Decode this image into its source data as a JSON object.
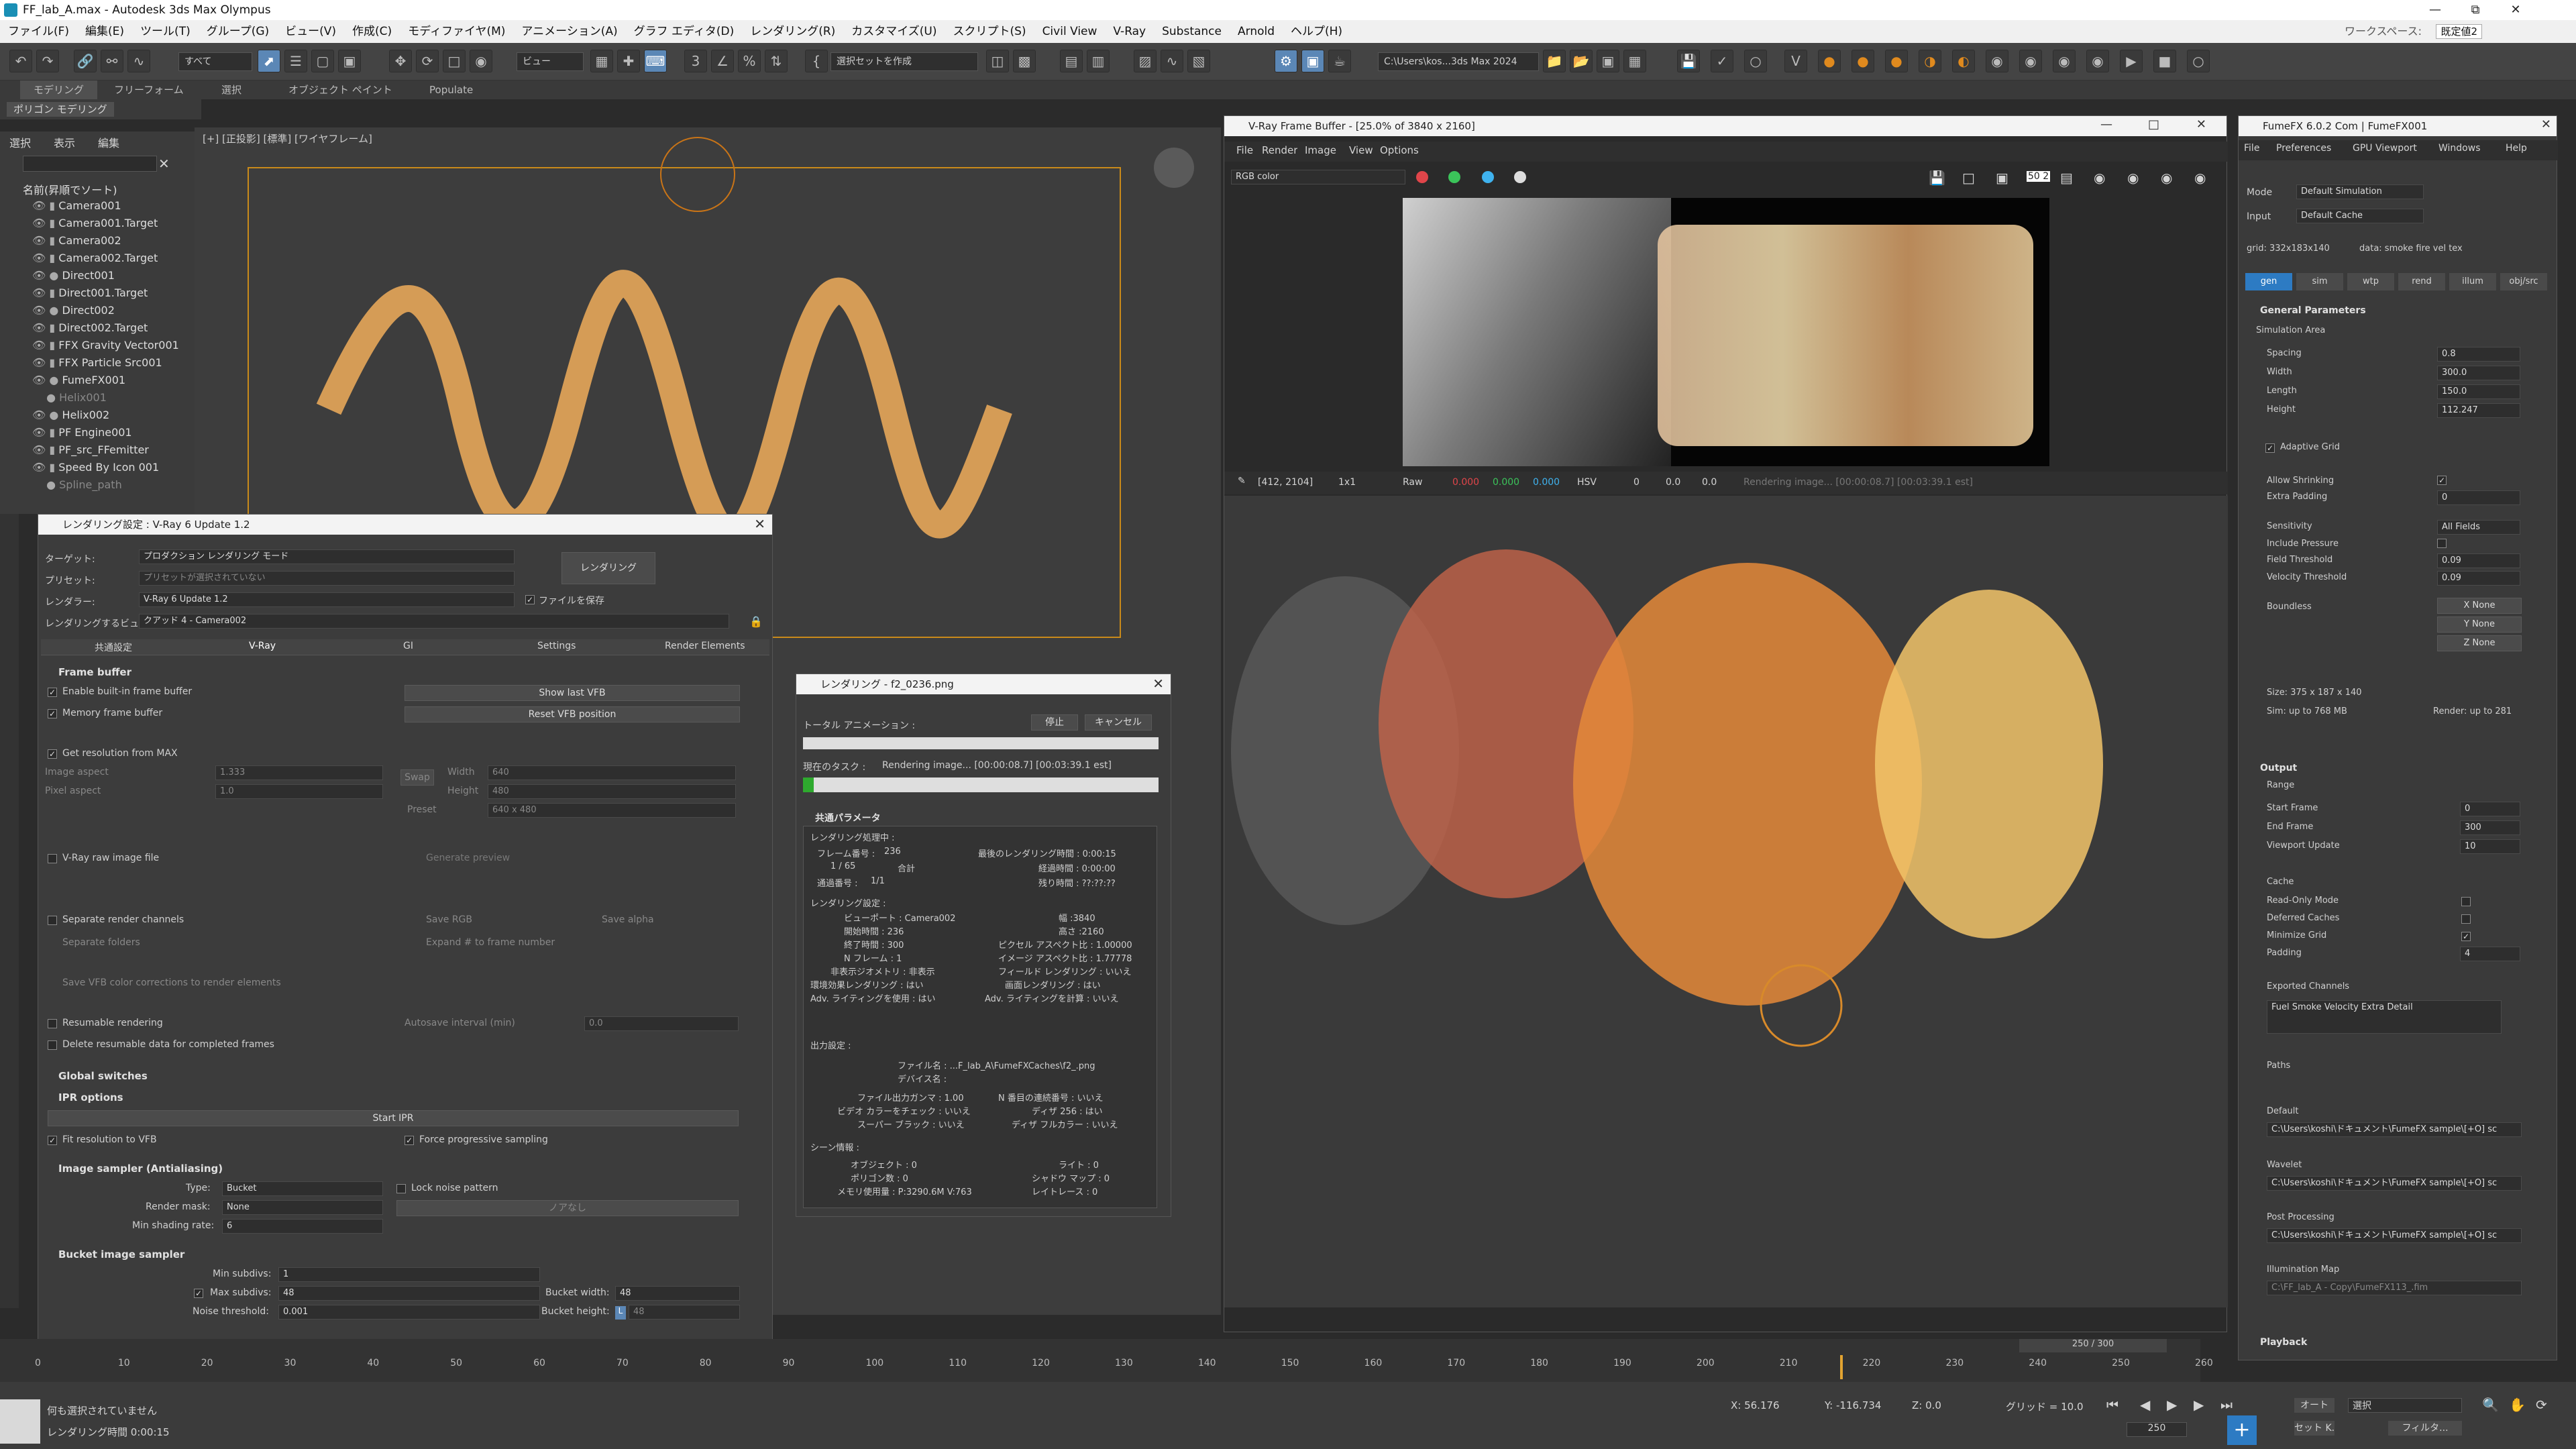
{
  "window": {
    "title": "FF_lab_A.max - Autodesk 3ds Max Olympus"
  },
  "menu": [
    "ファイル(F)",
    "編集(E)",
    "ツール(T)",
    "グループ(G)",
    "ビュー(V)",
    "作成(C)",
    "モディファイヤ(M)",
    "アニメーション(A)",
    "グラフ エディタ(D)",
    "レンダリング(R)",
    "カスタマイズ(U)",
    "スクリプト(S)",
    "Civil View",
    "V-Ray",
    "Substance",
    "Arnold",
    "ヘルプ(H)"
  ],
  "workspace": {
    "label": "ワークスペース:",
    "value": "既定値2"
  },
  "toolbar": {
    "filter": "すべて",
    "view": "ビュー",
    "selection_set": "選択セットを作成",
    "path": "C:\\Users\\kos...3ds Max 2024"
  },
  "ribbon": {
    "tabs": [
      "モデリング",
      "フリーフォーム",
      "選択",
      "オブジェクト ペイント",
      "Populate"
    ],
    "sub": "ポリゴン モデリング"
  },
  "scene_explorer": {
    "menu": [
      "選択",
      "表示",
      "編集"
    ],
    "header": "名前(昇順でソート)",
    "items": [
      "Camera001",
      "Camera001.Target",
      "Camera002",
      "Camera002.Target",
      "Direct001",
      "Direct001.Target",
      "Direct002",
      "Direct002.Target",
      "FFX Gravity Vector001",
      "FFX Particle Src001",
      "FumeFX001",
      "Helix001",
      "Helix002",
      "PF Engine001",
      "PF_src_FFemitter",
      "Speed By Icon 001",
      "Spline_path"
    ]
  },
  "viewport": {
    "label": "[+] [正投影] [標準] [ワイヤフレーム]"
  },
  "render_setup": {
    "title": "レンダリング設定 : V-Ray 6 Update 1.2",
    "target_label": "ターゲット:",
    "target": "プロダクション レンダリング モード",
    "preset_label": "プリセット:",
    "preset": "プリセットが選択されていない",
    "renderer_label": "レンダラー:",
    "renderer": "V-Ray 6 Update 1.2",
    "save_file": "ファイルを保存",
    "render_button": "レンダリング",
    "view_label": "レンダリングするビュー:",
    "view": "クアッド 4 - Camera002",
    "tabs": [
      "共通設定",
      "V-Ray",
      "GI",
      "Settings",
      "Render Elements"
    ],
    "frame_buffer": "Frame buffer",
    "enable_vfb": "Enable built-in frame buffer",
    "memory_fb": "Memory frame buffer",
    "show_last_vfb": "Show last VFB",
    "reset_vfb": "Reset VFB position",
    "get_res": "Get resolution from MAX",
    "image_aspect": "Image aspect",
    "image_aspect_val": "1.333",
    "pixel_aspect": "Pixel aspect",
    "pixel_aspect_val": "1.0",
    "swap": "Swap",
    "width": "Width",
    "width_val": "640",
    "height": "Height",
    "height_val": "480",
    "preset2": "Preset",
    "preset2_val": "640 x 480",
    "raw_file": "V-Ray raw image file",
    "gen_preview": "Generate preview",
    "sep_channels": "Separate render channels",
    "save_rgb": "Save RGB",
    "save_alpha": "Save alpha",
    "sep_folders": "Separate folders",
    "expand": "Expand # to frame number",
    "save_vfb_corr": "Save VFB color corrections to render elements",
    "resumable": "Resumable rendering",
    "autosave": "Autosave interval (min)",
    "autosave_val": "0.0",
    "delete_resumable": "Delete resumable data for completed frames",
    "global_switches": "Global switches",
    "ipr": "IPR options",
    "start_ipr": "Start IPR",
    "fit_res": "Fit resolution to VFB",
    "force_prog": "Force progressive sampling",
    "image_sampler": "Image sampler (Antialiasing)",
    "type_label": "Type:",
    "type": "Bucket",
    "lock_noise": "Lock noise pattern",
    "render_mask": "Render mask:",
    "render_mask_val": "None",
    "mask_btn": "ノアなし",
    "min_shading": "Min shading rate:",
    "min_shading_val": "6",
    "bucket_sampler": "Bucket image sampler",
    "min_subdivs": "Min subdivs:",
    "min_subdivs_val": "1",
    "max_subdivs": "Max subdivs:",
    "max_subdivs_val": "48",
    "noise_th": "Noise threshold:",
    "noise_th_val": "0.001",
    "bucket_w": "Bucket width:",
    "bucket_w_val": "48",
    "bucket_h": "Bucket height:",
    "bucket_h_val": "48",
    "bucket_h_lock": "L"
  },
  "render_progress": {
    "title": "レンダリング - f2_0236.png",
    "stop": "停止",
    "cancel": "キャンセル",
    "total_anim": "トータル アニメーション :",
    "current_task": "現在のタスク :",
    "task": "Rendering image... [00:00:08.7] [00:03:39.1 est]",
    "common": "共通パラメータ",
    "rendering_progress": "レンダリング処理中 :",
    "frame_no_l": "フレーム番号 :",
    "frame_no": "236",
    "frames_l": "1 / 65",
    "total": "合計",
    "pass_l": "通過番号 :",
    "pass": "1/1",
    "last_time": "最後のレンダリング時間 : 0:00:15",
    "elapsed": "経過時間 : 0:00:00",
    "remaining": "残り時間 : ??:??:??",
    "settings_l": "レンダリング設定 :",
    "s": [
      "ビューポート : Camera002",
      "幅 :3840",
      "開始時間 : 236",
      "高さ :2160",
      "終了時間 : 300",
      "ピクセル アスペクト比 : 1.00000",
      "N フレーム : 1",
      "イメージ アスペクト比 : 1.77778",
      "非表示ジオメトリ : 非表示",
      "フィールド レンダリング : いいえ",
      "環境効果レンダリング : はい",
      "画面レンダリング : はい",
      "Adv. ライティングを使用 : はい",
      "Adv. ライティングを計算 : いいえ"
    ],
    "output_l": "出力設定 :",
    "file": "ファイル名 : ...F_lab_A\\FumeFXCaches\\f2_.png",
    "device": "デバイス名 :",
    "o": [
      "ファイル出力ガンマ : 1.00",
      "N 番目の連続番号 : いいえ",
      "ビデオ カラーをチェック : いいえ",
      "ディザ 256 : はい",
      "スーパー ブラック : いいえ",
      "ディザ フルカラー : いいえ"
    ],
    "scene_l": "シーン情報 :",
    "sc": [
      "オブジェクト : 0",
      "ライト : 0",
      "ポリゴン数 : 0",
      "シャドウ マップ : 0",
      "メモリ使用量 : P:3290.6M V:763",
      "レイトレース : 0"
    ]
  },
  "vfb": {
    "title": "V-Ray Frame Buffer - [25.0% of 3840 x 2160]",
    "menu": [
      "File",
      "Render",
      "Image",
      "View",
      "Options"
    ],
    "channel": "RGB color",
    "coords": "[412, 2104]",
    "zoom": "1x1",
    "raw": "Raw",
    "r": "0.000",
    "g": "0.000",
    "b": "0.000",
    "mode": "HSV",
    "h": "0",
    "s": "0.0",
    "v": "0.0",
    "status": "Rendering image... [00:00:08.7] [00:03:39.1 est]",
    "badge": "50 2"
  },
  "fumefx": {
    "title": "FumeFX 6.0.2 Com | FumeFX001",
    "menu": [
      "File",
      "Preferences",
      "GPU Viewport",
      "Windows",
      "Help"
    ],
    "mode_l": "Mode",
    "mode": "Default Simulation",
    "input_l": "Input",
    "input": "Default Cache",
    "grid": "grid: 332x183x140",
    "data": "data: smoke fire vel tex",
    "tabs": [
      "gen",
      "sim",
      "wtp",
      "rend",
      "illum",
      "obj/src"
    ],
    "general": "General Parameters",
    "sim_area": "Simulation Area",
    "spacing_l": "Spacing",
    "spacing": "0.8",
    "width_l": "Width",
    "width": "300.0",
    "length_l": "Length",
    "length": "150.0",
    "height_l": "Height",
    "height": "112.247",
    "adaptive": "Adaptive Grid",
    "allow_shrink": "Allow Shrinking",
    "extra_pad": "Extra Padding",
    "extra_pad_val": "0",
    "sensitivity": "Sensitivity",
    "sensitivity_val": "All Fields",
    "incl_pressure": "Include Pressure",
    "field_th": "Field Threshold",
    "field_th_val": "0.09",
    "vel_th": "Velocity Threshold",
    "vel_th_val": "0.09",
    "boundless": "Boundless",
    "xb": "X None",
    "yb": "Y None",
    "zb": "Z None",
    "size": "Size: 375 x 187 x 140",
    "sim_mem": "Sim: up to 768 MB",
    "render_mem": "Render: up to 281",
    "output": "Output",
    "range": "Range",
    "start_frame": "Start Frame",
    "start_frame_val": "0",
    "end_frame": "End Frame",
    "end_frame_val": "300",
    "vp_update": "Viewport Update",
    "vp_update_val": "10",
    "cache": "Cache",
    "readonly": "Read-Only Mode",
    "deferred": "Deferred Caches",
    "minimize": "Minimize Grid",
    "padding": "Padding",
    "padding_val": "4",
    "exported": "Exported Channels",
    "exported_val": "Fuel Smoke Velocity Extra Detail",
    "paths": "Paths",
    "default": "Default",
    "default_val": "C:\\Users\\koshi\\ドキュメント\\FumeFX sample\\[+O] sc",
    "wavelet": "Wavelet",
    "wavelet_val": "C:\\Users\\koshi\\ドキュメント\\FumeFX sample\\[+O] sc",
    "post": "Post Processing",
    "post_val": "C:\\Users\\koshi\\ドキュメント\\FumeFX sample\\[+O] sc",
    "illum_map": "Illumination Map",
    "illum_val": "C:\\FF_lab_A - Copy\\FumeFX113_.fim",
    "playback": "Playback",
    "range2": "Range"
  },
  "timeline": {
    "frame": "250 / 300",
    "ticks": [
      "0",
      "10",
      "20",
      "30",
      "40",
      "50",
      "60",
      "70",
      "80",
      "90",
      "100",
      "110",
      "120",
      "130",
      "140",
      "150",
      "160",
      "170",
      "180",
      "190",
      "200",
      "210",
      "220",
      "230",
      "240",
      "250",
      "260"
    ],
    "current": 250,
    "max": 300
  },
  "status": {
    "sel": "何も選択されていません",
    "time": "レンダリング時間 0:00:15",
    "x": "X: 56.176",
    "y": "Y: -116.734",
    "z": "Z: 0.0",
    "grid": "グリッド = 10.0",
    "frame": "250",
    "auto": "オート",
    "sel_set": "選択",
    "setkey": "セット K.",
    "filter": "フィルタ..."
  }
}
